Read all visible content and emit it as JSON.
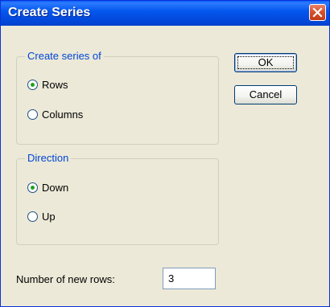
{
  "window": {
    "title": "Create Series",
    "close_icon": "close-icon"
  },
  "series_group": {
    "legend": "Create series of",
    "options": [
      {
        "label": "Rows",
        "checked": true
      },
      {
        "label": "Columns",
        "checked": false
      }
    ]
  },
  "direction_group": {
    "legend": "Direction",
    "options": [
      {
        "label": "Down",
        "checked": true
      },
      {
        "label": "Up",
        "checked": false
      }
    ]
  },
  "buttons": {
    "ok_label": "OK",
    "cancel_label": "Cancel"
  },
  "rows_field": {
    "label": "Number of new rows:",
    "value": "3"
  },
  "colors": {
    "title_bar": "#0558ee",
    "dialog_background": "#ece9d8",
    "legend_text": "#0046d5",
    "close_button": "#d8522e",
    "radio_dot": "#21a121"
  }
}
